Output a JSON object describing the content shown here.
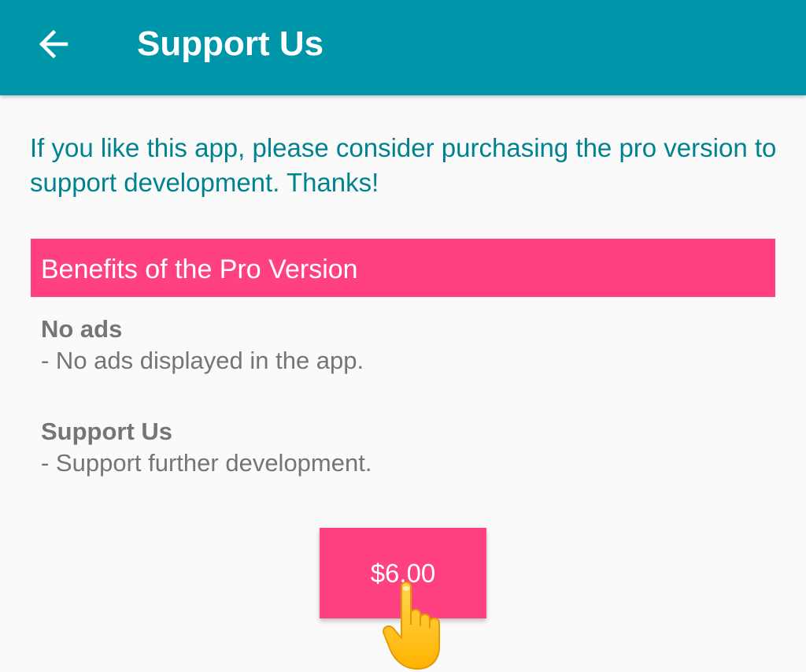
{
  "app_bar": {
    "title": "Support Us",
    "back_icon": "arrow-back-icon",
    "color": "#0096aa"
  },
  "intro_text": "If you like this app, please consider purchasing the pro version to support development. Thanks!",
  "benefits": {
    "header": "Benefits of the Pro Version",
    "items": [
      {
        "title": "No ads",
        "description": "- No ads displayed in the app."
      },
      {
        "title": "Support Us",
        "description": "- Support further development."
      }
    ]
  },
  "purchase_button": {
    "label": "$6.00"
  },
  "overlay": {
    "pointer_icon": "pointing-hand-icon"
  },
  "colors": {
    "accent": "#ff4081",
    "intro_text": "#00838f",
    "body_text": "#757575",
    "background": "#fafafa"
  }
}
